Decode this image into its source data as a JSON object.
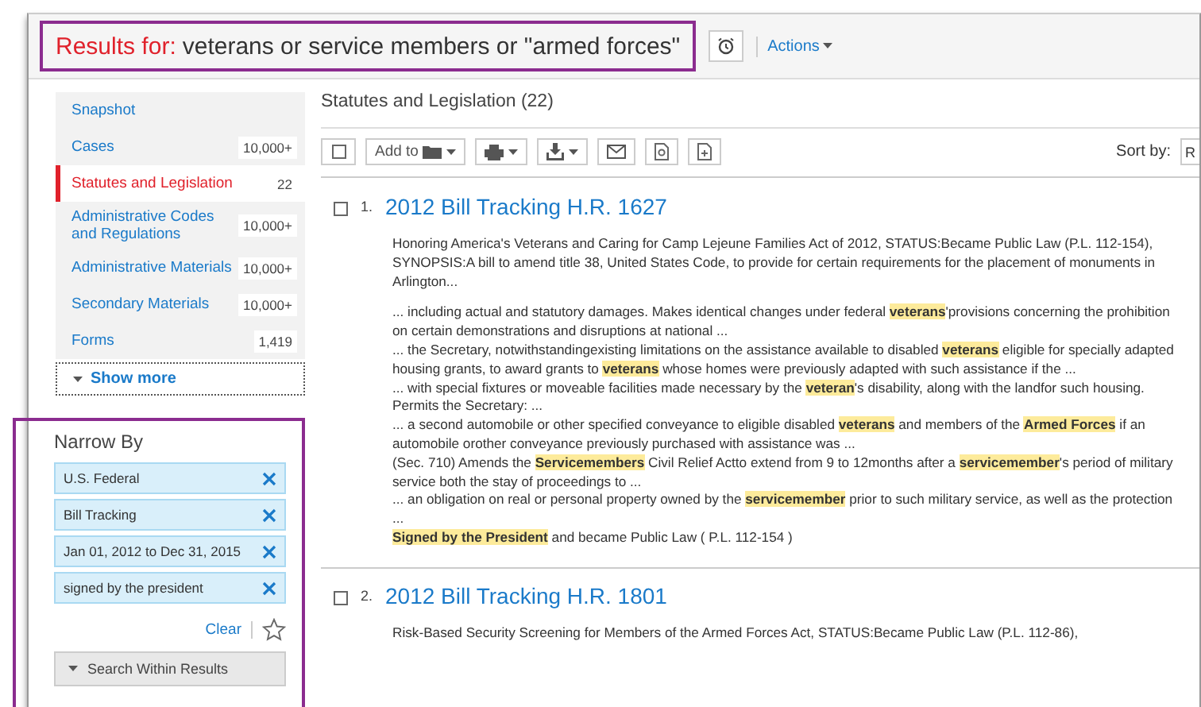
{
  "header": {
    "label": "Results for:",
    "query": "veterans or service members or \"armed forces\"",
    "actions": "Actions"
  },
  "sidebar": {
    "items": [
      {
        "label": "Snapshot",
        "selected": false
      },
      {
        "label": "Cases",
        "count": "10,000+",
        "selected": false
      },
      {
        "label": "Statutes and Legislation",
        "count": "22",
        "selected": true
      },
      {
        "label": "Administrative Codes and Regulations",
        "count": "10,000+",
        "selected": false
      },
      {
        "label": "Administrative Materials",
        "count": "10,000+",
        "selected": false
      },
      {
        "label": "Secondary Materials",
        "count": "10,000+",
        "selected": false
      },
      {
        "label": "Forms",
        "count": "1,419",
        "selected": false
      }
    ],
    "show_more": "Show more"
  },
  "narrow_by": {
    "title": "Narrow By",
    "filters": [
      "U.S. Federal",
      "Bill Tracking",
      "Jan 01, 2012 to Dec 31, 2015",
      "signed by the president"
    ],
    "clear": "Clear",
    "search_within": "Search Within Results"
  },
  "results": {
    "heading": "Statutes and Legislation (22)",
    "toolbar": {
      "select_all_checked": false,
      "add_to": "Add to",
      "sort_label": "Sort by:",
      "sort_value": "R"
    },
    "items": [
      {
        "number": "1.",
        "title": "2012 Bill Tracking H.R. 1627",
        "checked": false,
        "summary": "Honoring America's Veterans and Caring for Camp Lejeune Families Act of 2012, STATUS:Became Public Law (P.L. 112-154), SYNOPSIS:A bill to amend title 38, United States Code, to provide for certain requirements for the placement of monuments in Arlington...",
        "snippets": [
          "... including actual and statutory damages. Makes identical changes under federal **veterans**'provisions concerning the prohibition on certain demonstrations and disruptions at national ...",
          "... the Secretary, notwithstandingexisting limitations on the assistance available to disabled **veterans** eligible for specially adapted housing grants, to award grants to **veterans** whose homes were previously adapted with such assistance if the ...",
          "... with special fixtures or moveable facilities made necessary by the **veteran**'s disability, along with the landfor such housing. Permits the Secretary: ...",
          "... a second automobile or other specified conveyance to eligible disabled **veterans** and members of the **Armed Forces** if an automobile orother conveyance previously purchased with assistance was ...",
          "(Sec. 710) Amends the **Servicemembers** Civil Relief Actto extend from 9 to 12months after a **servicemember**'s period of military service both the stay of proceedings to ...",
          "... an obligation on real or personal property owned by the **servicemember** prior to such military service, as well as the protection ...",
          "**Signed by the President** and became Public Law ( P.L. 112-154 )"
        ]
      },
      {
        "number": "2.",
        "title": "2012 Bill Tracking H.R. 1801",
        "checked": false,
        "summary": "Risk-Based Security Screening for Members of the Armed Forces Act, STATUS:Became Public Law (P.L. 112-86),"
      }
    ]
  }
}
